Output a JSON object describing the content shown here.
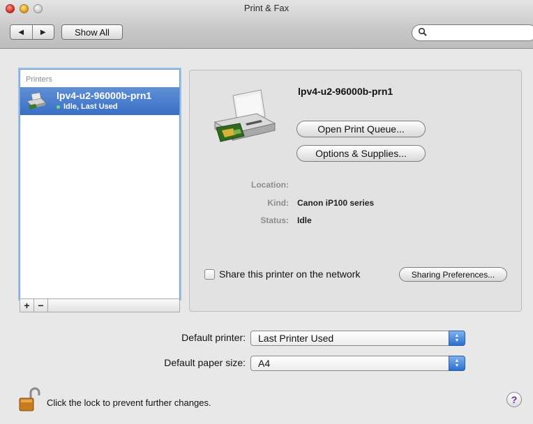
{
  "window": {
    "title": "Print & Fax"
  },
  "toolbar": {
    "back_label": "◀",
    "forward_label": "▶",
    "show_all_label": "Show All",
    "search_placeholder": "",
    "icons": {
      "back": "left-arrow-icon",
      "forward": "right-arrow-icon",
      "search": "search-icon"
    }
  },
  "printers": {
    "header": "Printers",
    "items": [
      {
        "name": "lpv4-u2-96000b-prn1",
        "status": "Idle, Last Used",
        "selected": true
      }
    ],
    "add_label": "+",
    "remove_label": "−"
  },
  "detail": {
    "name": "lpv4-u2-96000b-prn1",
    "open_queue_label": "Open Print Queue...",
    "options_label": "Options & Supplies...",
    "location_key": "Location:",
    "location_val": "",
    "kind_key": "Kind:",
    "kind_val": "Canon iP100 series",
    "status_key": "Status:",
    "status_val": "Idle",
    "share_label": "Share this printer on the network",
    "share_checked": false,
    "sharing_prefs_label": "Sharing Preferences..."
  },
  "defaults": {
    "printer_label": "Default printer:",
    "printer_value": "Last Printer Used",
    "paper_label": "Default paper size:",
    "paper_value": "A4"
  },
  "footer": {
    "lock_text": "Click the lock to prevent further changes.",
    "help_label": "?"
  },
  "colors": {
    "selection": "#3a6fc4",
    "help_glyph": "#6b2ca8"
  }
}
